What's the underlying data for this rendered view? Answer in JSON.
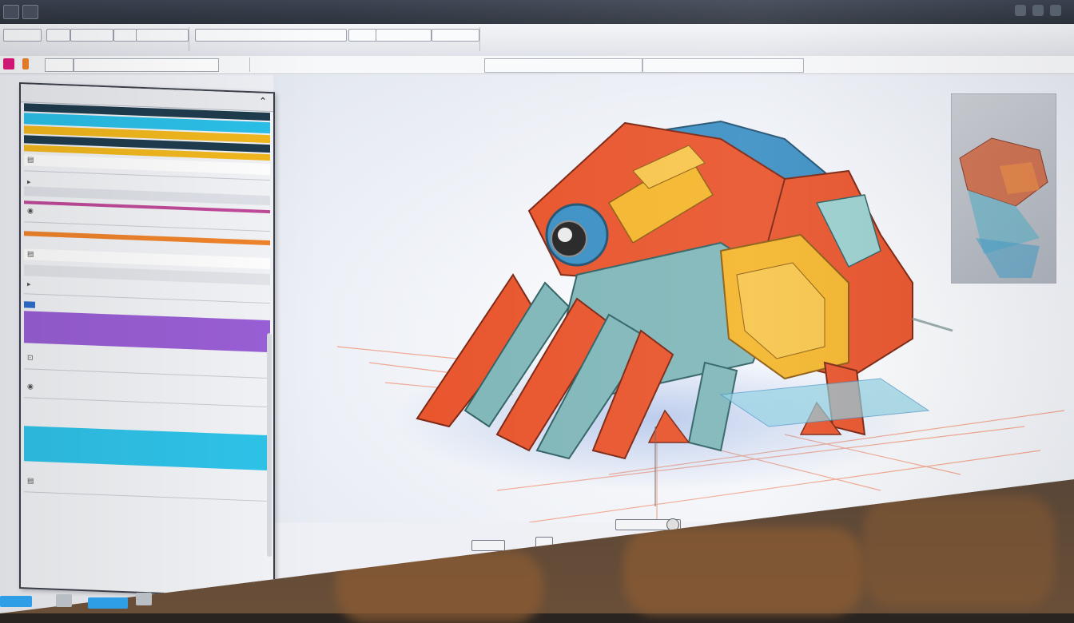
{
  "window": {
    "title": "",
    "titlebar_buttons": [
      "menu-icon",
      "window-icon"
    ]
  },
  "ribbon": {
    "items": [
      "",
      "",
      "",
      "",
      "",
      "",
      "",
      "",
      ""
    ]
  },
  "toolbar": {
    "chips": [
      "",
      ""
    ],
    "accent_pink": "#e0187b",
    "accent_orange": "#f0842c"
  },
  "breadcrumb": "",
  "layers_panel": {
    "title": "",
    "collapse_icon": "chevron-up-icon",
    "rows": [
      {
        "label": "",
        "value": "",
        "color": "#e0e3e9"
      },
      {
        "label": "",
        "value": "",
        "color": "#2bc0e8"
      },
      {
        "label": "",
        "value": "",
        "color": "#f2b81e"
      },
      {
        "label": "",
        "value": "",
        "color": "#1f3c4e"
      },
      {
        "label": "",
        "value": "",
        "color": "#f2b81e"
      },
      {
        "label": "",
        "value": "",
        "color": "#ffffff"
      }
    ],
    "groups": [
      {
        "label": "",
        "value": ""
      },
      {
        "label": "",
        "value": ""
      },
      {
        "label": "",
        "value": ""
      },
      {
        "label": "",
        "value": ""
      },
      {
        "label": "",
        "value": ""
      }
    ],
    "highlight_purple": {
      "label": "",
      "color": "#9a5fd6"
    },
    "highlight_cyan": {
      "label": "",
      "sub": "",
      "color": "#2fc4ea"
    },
    "footer_rows": [
      "",
      "",
      ""
    ]
  },
  "viewport": {
    "model": "3d-mech-model",
    "thumbnail": "model-preview-thumbnail",
    "colors": {
      "orange": "#e8532a",
      "teal": "#7fb6b8",
      "yellow": "#f4b52a",
      "blue": "#3a8fc4"
    }
  }
}
